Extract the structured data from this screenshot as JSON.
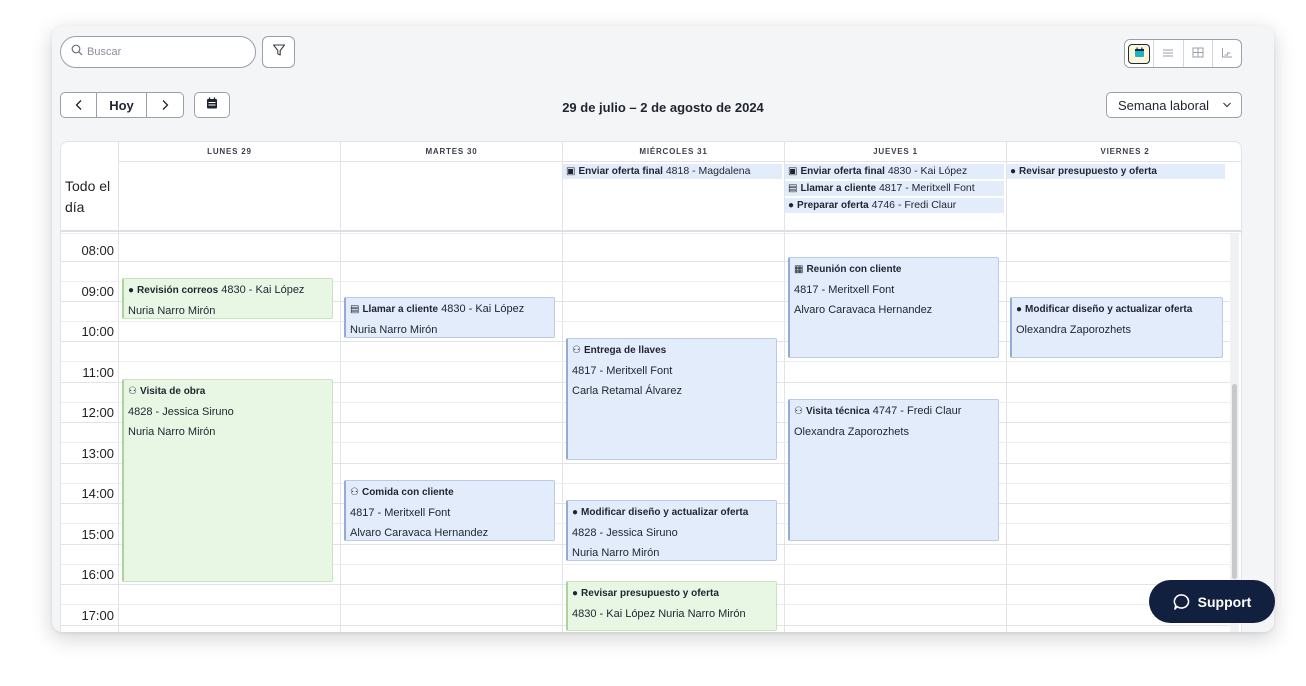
{
  "search": {
    "placeholder": "Buscar"
  },
  "icons": {
    "search": "search-icon",
    "filter": "filter-icon",
    "calendar": "calendar-icon",
    "list": "list-icon",
    "table": "table-icon",
    "chart": "chart-icon"
  },
  "nav": {
    "prev": "<",
    "today": "Hoy",
    "next": ">"
  },
  "range_title": "29 de julio – 2 de agosto de 2024",
  "view_select": "Semana laboral",
  "allday_label": "Todo el día",
  "days": [
    "LUNES 29",
    "MARTES 30",
    "MIÉRCOLES 31",
    "JUEVES 1",
    "VIERNES 2"
  ],
  "times": [
    "08:00",
    "09:00",
    "10:00",
    "11:00",
    "12:00",
    "13:00",
    "14:00",
    "15:00",
    "16:00",
    "17:00"
  ],
  "allday_events": [
    {
      "title": "Enviar oferta final",
      "detail": " 4818 - Magdalena"
    },
    {
      "title": "Enviar oferta final",
      "detail": " 4830 - Kai López"
    },
    {
      "title": "Llamar a cliente",
      "detail": " 4817 - Meritxell Font"
    },
    {
      "title": "Preparar oferta",
      "detail": " 4746 - Fredi Claur"
    },
    {
      "title": "Revisar presupuesto y oferta",
      "detail": ""
    }
  ],
  "events": [
    {
      "title": "Revisión correos",
      "inline": " 4830 - Kai López",
      "lines": [
        "Nuria Narro Mirón"
      ],
      "color": "green"
    },
    {
      "title": "Visita de obra",
      "inline": "",
      "lines": [
        "4828 - Jessica Siruno",
        "Nuria Narro Mirón"
      ],
      "color": "green"
    },
    {
      "title": "Llamar a cliente",
      "inline": " 4830 - Kai López",
      "lines": [
        "Nuria Narro Mirón"
      ],
      "color": "blue"
    },
    {
      "title": "Comida con cliente",
      "inline": "",
      "lines": [
        "4817 - Meritxell Font",
        "Alvaro Caravaca Hernandez"
      ],
      "color": "blue"
    },
    {
      "title": "Entrega de llaves",
      "inline": "",
      "lines": [
        "4817 - Meritxell Font",
        "Carla Retamal Álvarez"
      ],
      "color": "blue"
    },
    {
      "title": "Modificar diseño y actualizar oferta",
      "inline": "",
      "lines": [
        "4828 - Jessica Siruno",
        "Nuria Narro Mirón"
      ],
      "color": "blue"
    },
    {
      "title": "Revisar presupuesto y oferta",
      "inline": "",
      "lines": [
        "4830 - Kai López Nuria Narro Mirón"
      ],
      "color": "green"
    },
    {
      "title": "Reunión con cliente",
      "inline": "",
      "lines": [
        "4817 - Meritxell Font",
        "Alvaro Caravaca Hernandez"
      ],
      "color": "blue"
    },
    {
      "title": "Visita técnica",
      "inline": " 4747 - Fredi Claur",
      "lines": [
        "Olexandra Zaporozhets"
      ],
      "color": "blue"
    },
    {
      "title": "Modificar diseño y actualizar oferta",
      "inline": "",
      "lines": [
        "Olexandra Zaporozhets"
      ],
      "color": "blue"
    }
  ],
  "support": {
    "label": "Support"
  }
}
